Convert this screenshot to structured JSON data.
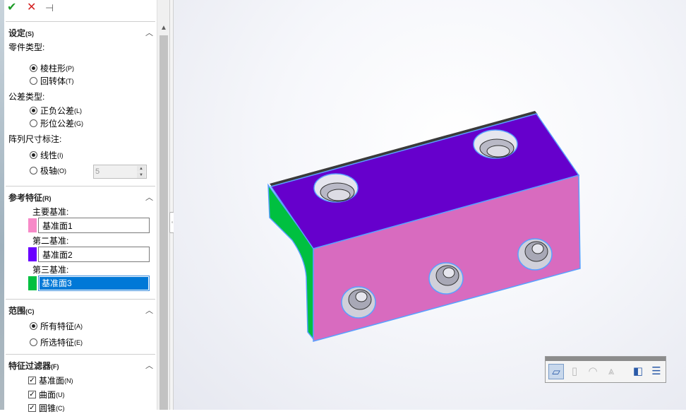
{
  "toolbar": {
    "ok": "✔",
    "cancel": "✕",
    "pin": "⊣"
  },
  "settings": {
    "title": "设定",
    "title_key": "(S)",
    "part_type_label": "零件类型:",
    "part_types": [
      {
        "label": "棱柱形",
        "key": "(P)",
        "checked": true
      },
      {
        "label": "回转体",
        "key": "(T)",
        "checked": false
      }
    ],
    "tol_type_label": "公差类型:",
    "tol_types": [
      {
        "label": "正负公差",
        "key": "(L)",
        "checked": true
      },
      {
        "label": "形位公差",
        "key": "(G)",
        "checked": false
      }
    ],
    "pattern_label": "阵列尺寸标注:",
    "pattern_types": [
      {
        "label": "线性",
        "key": "(I)",
        "checked": true
      },
      {
        "label": "极轴",
        "key": "(O)",
        "checked": false
      }
    ],
    "polar_count": "5"
  },
  "reference": {
    "title": "参考特征",
    "title_key": "(R)",
    "primary_label": "主要基准:",
    "primary_value": "基准面1",
    "primary_color": "#f78ac8",
    "secondary_label": "第二基准:",
    "secondary_value": "基准面2",
    "secondary_color": "#6a00ff",
    "tertiary_label": "第三基准:",
    "tertiary_value": "基准面3",
    "tertiary_color": "#00c040"
  },
  "scope": {
    "title": "范围",
    "title_key": "(C)",
    "options": [
      {
        "label": "所有特征",
        "key": "(A)",
        "checked": true
      },
      {
        "label": "所选特征",
        "key": "(E)",
        "checked": false
      }
    ]
  },
  "filter": {
    "title": "特征过滤器",
    "title_key": "(F)",
    "items": [
      {
        "label": "基准面",
        "key": "(N)",
        "checked": true
      },
      {
        "label": "曲面",
        "key": "(U)",
        "checked": true
      },
      {
        "label": "圆锥",
        "key": "(C)",
        "checked": true
      }
    ]
  },
  "model_colors": {
    "top": "#6600cc",
    "front": "#d86bbf",
    "side": "#00c040",
    "edge": "#5aa0ff"
  },
  "hud_icons": [
    "box-select-icon",
    "cylinder-icon",
    "torus-icon",
    "cones-icon",
    "mirror-planes-icon",
    "align-planes-icon"
  ]
}
